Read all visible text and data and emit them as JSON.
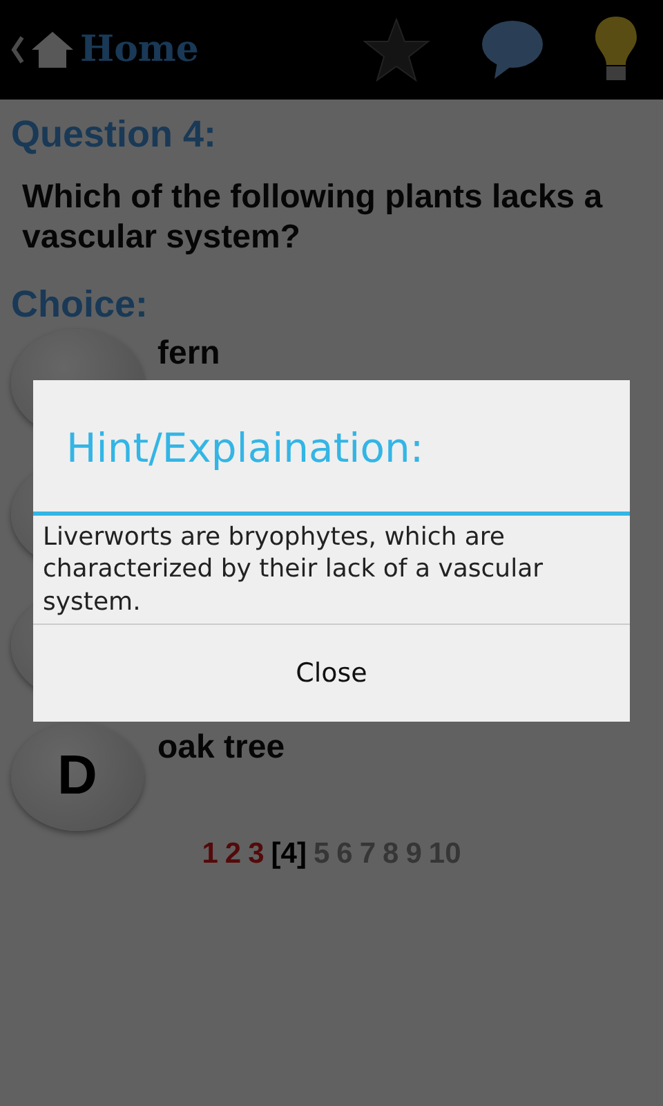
{
  "top_bar": {
    "home_label": "Home"
  },
  "question": {
    "heading": "Question 4:",
    "text": "Which of the following plants lacks a vascular system?"
  },
  "choice_heading": "Choice:",
  "choices": [
    {
      "kind": "answer",
      "text": "fern"
    },
    {
      "kind": "covered"
    },
    {
      "kind": "covered"
    },
    {
      "kind": "answer",
      "letter": "D",
      "text": "oak tree"
    }
  ],
  "pages": [
    {
      "label": "1",
      "kind": "answered"
    },
    {
      "label": "2",
      "kind": "answered"
    },
    {
      "label": "3",
      "kind": "answered"
    },
    {
      "label": "[4]",
      "kind": "current"
    },
    {
      "label": "5",
      "kind": "open"
    },
    {
      "label": "6",
      "kind": "open"
    },
    {
      "label": "7",
      "kind": "open"
    },
    {
      "label": "8",
      "kind": "open"
    },
    {
      "label": "9",
      "kind": "open"
    },
    {
      "label": "10",
      "kind": "open"
    }
  ],
  "dialog": {
    "title": "Hint/Explaination:",
    "message": "Liverworts are bryophytes, which are characterized by their lack of a vascular system.",
    "button": "Close"
  }
}
